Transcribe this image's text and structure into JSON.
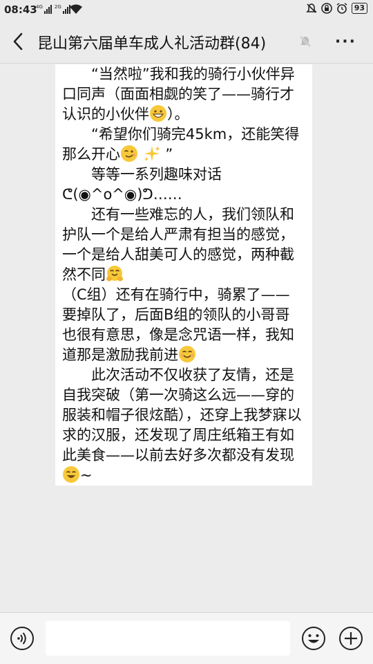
{
  "status_bar": {
    "time": "08:43",
    "signal1_tag": "4G",
    "signal2_tag": "2G",
    "battery": "93"
  },
  "header": {
    "title": "昆山第六届单车成人礼活动群(84)",
    "icons": [
      "back-chevron-icon",
      "mute-bell-icon",
      "more-dots-icon"
    ],
    "more_label": "···"
  },
  "message": {
    "paragraphs": [
      "　　“当然啦”我和我的骑行小伙伴异口同声（面面相觑的笑了——骑行才认识的小伙伴",
      "）。",
      "　　“希望你们骑完45km，还能笑得那么开心",
      " ”",
      "　　等等一系列趣味对话ᕦ(◉^o^◉)ᕤ……",
      "　　还有一些难忘的人，我们领队和护队一个是给人严肃有担当的感觉，一个是给人甜美可人的感觉，两种截然不同",
      "（C组）还有在骑行中，骑累了——要掉队了，后面B组的领队的小哥哥也很有意思，像是念咒语一样，我知道那是激励我前进",
      "　　此次活动不仅收获了友情，还是自我突破（第一次骑这么远——穿的服装和帽子很炫酷），还穿上我梦寐以求的汉服，还发现了周庄纸箱王有如此美食——以前去好多次都没有发现",
      "~"
    ],
    "emojis": [
      "grinning-face-emoji",
      "winking-face-emoji",
      "sparkles-emoji",
      "hugging-face-emoji",
      "smiling-face-emoji",
      "laughing-face-emoji"
    ]
  },
  "input_bar": {
    "placeholder": "",
    "icons": [
      "voice-icon",
      "emoji-icon",
      "plus-icon"
    ]
  },
  "colors": {
    "background": "#ececec",
    "bubble": "#ffffff",
    "text": "#111111",
    "emoji_yellow": "#f7c83a"
  }
}
